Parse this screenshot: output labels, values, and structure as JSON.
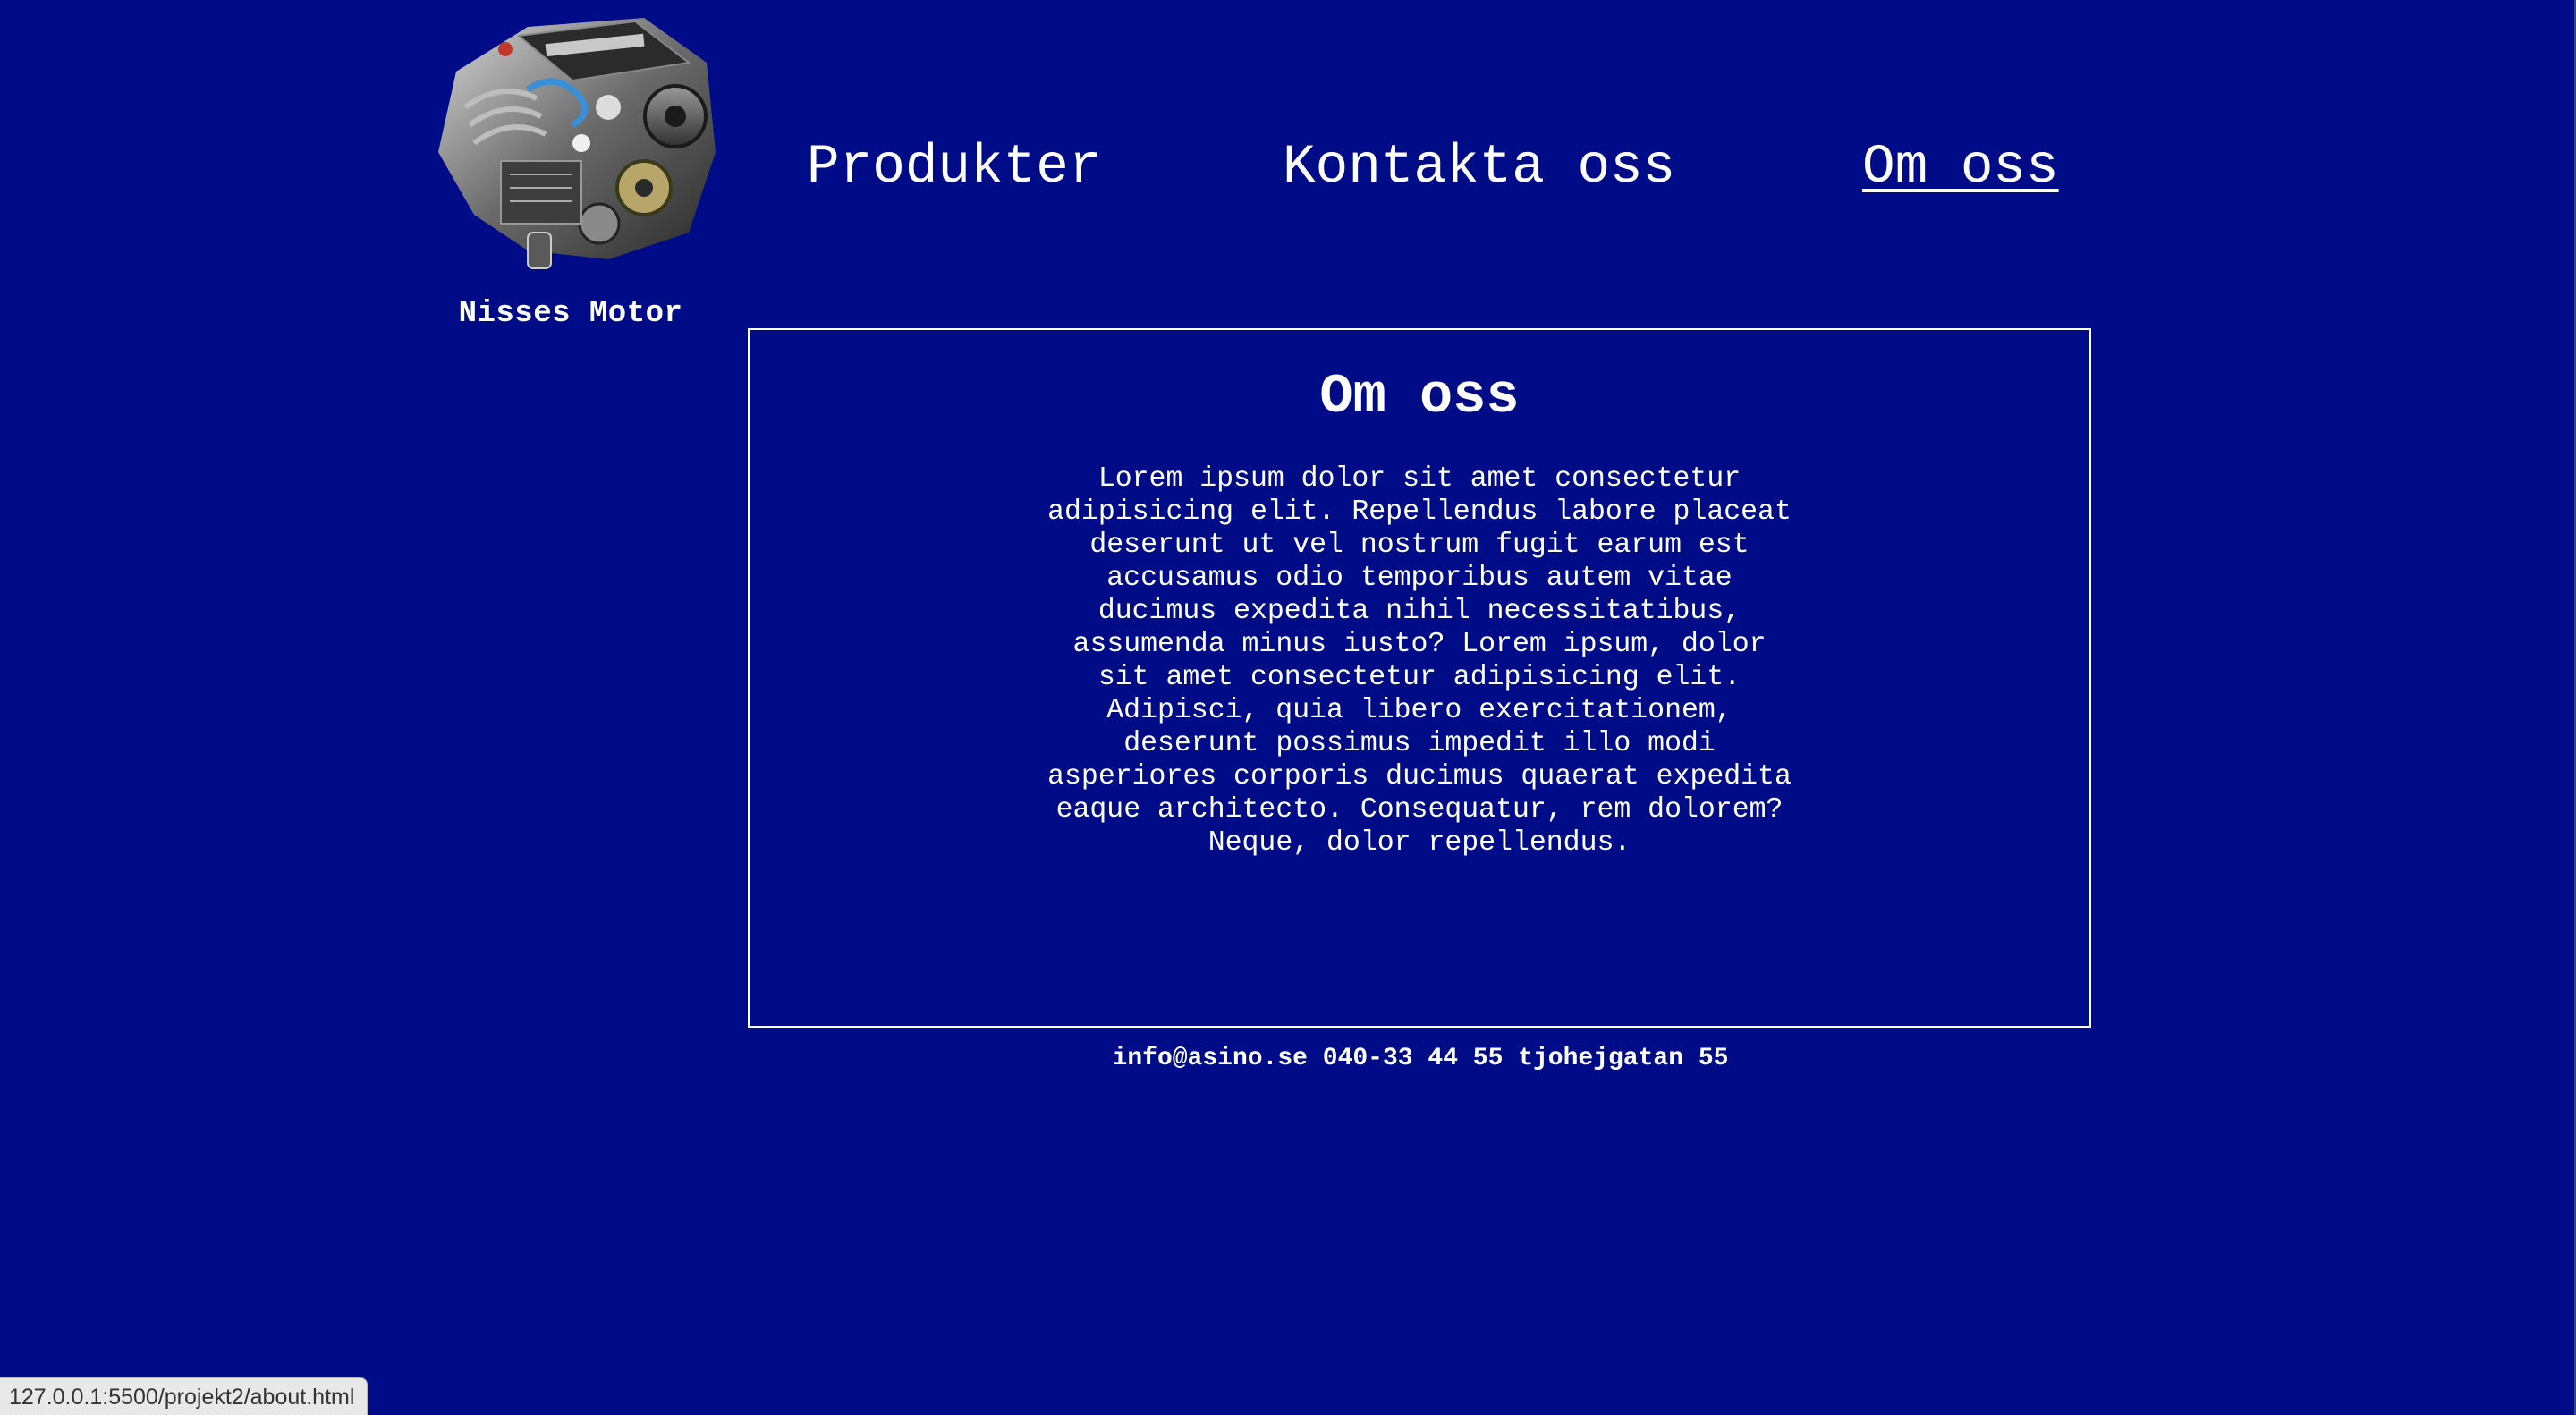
{
  "brand": {
    "name": "Nisses Motor",
    "logo_icon": "engine-icon"
  },
  "nav": {
    "items": [
      {
        "label": "Produkter",
        "active": false
      },
      {
        "label": "Kontakta oss",
        "active": false
      },
      {
        "label": "Om oss",
        "active": true
      }
    ]
  },
  "main": {
    "title": "Om oss",
    "body": "Lorem ipsum dolor sit amet consectetur adipisicing elit. Repellendus labore placeat deserunt ut vel nostrum fugit earum est accusamus odio temporibus autem vitae ducimus expedita nihil necessitatibus, assumenda minus iusto? Lorem ipsum, dolor sit amet consectetur adipisicing elit. Adipisci, quia libero exercitationem, deserunt possimus impedit illo modi asperiores corporis ducimus quaerat expedita eaque architecto. Consequatur, rem dolorem? Neque, dolor repellendus."
  },
  "footer": {
    "text": "info@asino.se 040-33 44 55 tjohejgatan 55"
  },
  "status_bar": {
    "url": "127.0.0.1:5500/projekt2/about.html"
  },
  "colors": {
    "background": "#000c87",
    "text": "#ffffff"
  }
}
